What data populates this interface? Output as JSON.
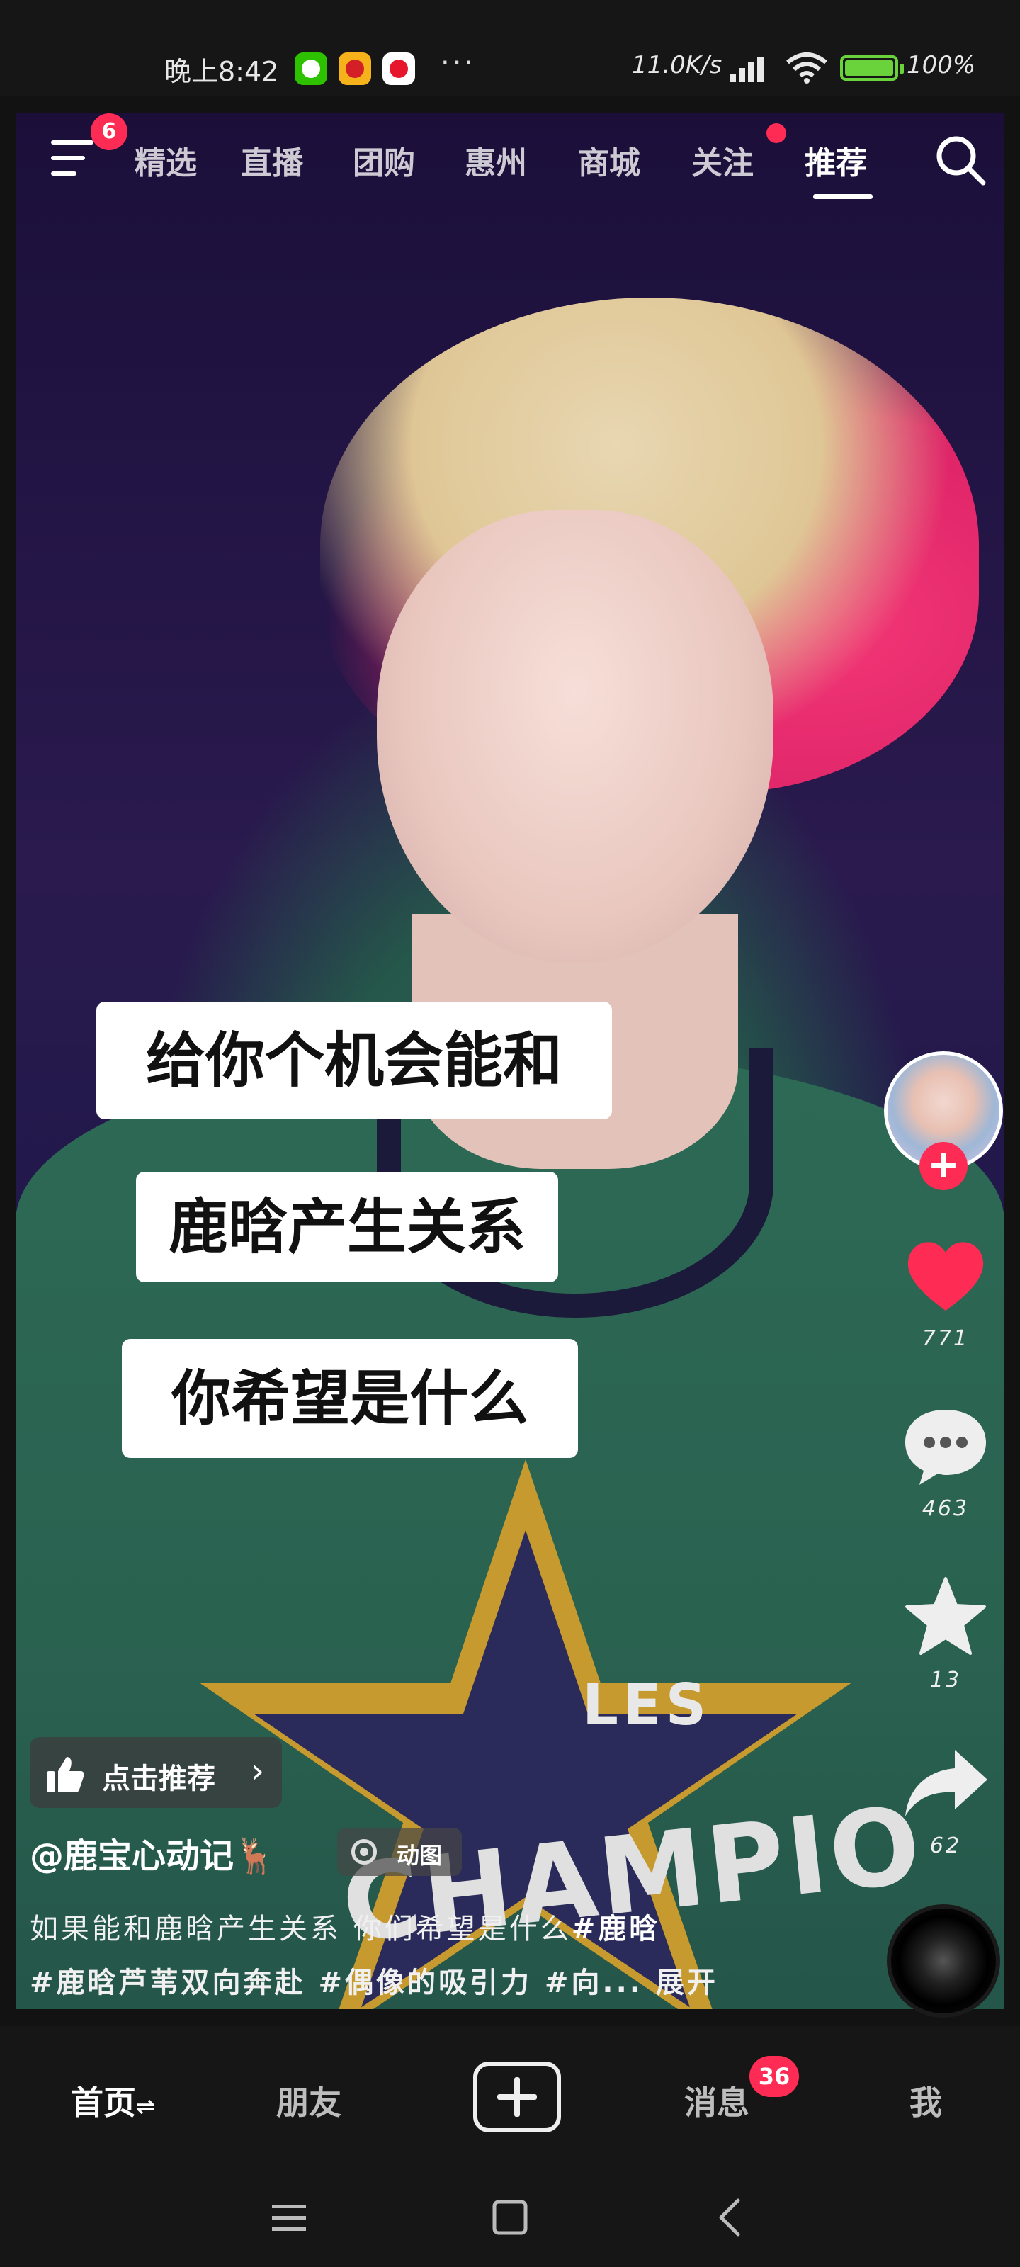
{
  "status_bar": {
    "time": "晚上8:42",
    "dots": "···",
    "net_speed": "11.0K/s",
    "battery": "100%"
  },
  "top_nav": {
    "menu_badge": "6",
    "tabs": [
      "精选",
      "直播",
      "团购",
      "惠州",
      "商城",
      "关注",
      "推荐"
    ],
    "active_tab": "推荐"
  },
  "captions": [
    "给你个机会能和",
    "鹿晗产生关系",
    "你希望是什么"
  ],
  "jersey": {
    "line1": "LES",
    "line2": "CHAMPIO"
  },
  "right_rail": {
    "like_count": "771",
    "comment_count": "463",
    "favorite_count": "13",
    "share_count": "62",
    "follow_label": "+"
  },
  "bottom_info": {
    "recommend_label": "点击推荐",
    "author": "@鹿宝心动记🦌",
    "tag": "动图",
    "desc_line1": "如果能和鹿晗产生关系  你们希望是什么",
    "desc_line1_tag": "#鹿晗",
    "desc_line2": "#鹿晗芦苇双向奔赴 #偶像的吸引力 #向...",
    "expand": "展开"
  },
  "bottom_nav": {
    "home": "首页",
    "home_suffix": "⇌",
    "friends": "朋友",
    "messages": "消息",
    "message_badge": "36",
    "me": "我"
  },
  "colors": {
    "accent": "#fe2c55",
    "background": "#161616",
    "like": "#fe2c55"
  }
}
